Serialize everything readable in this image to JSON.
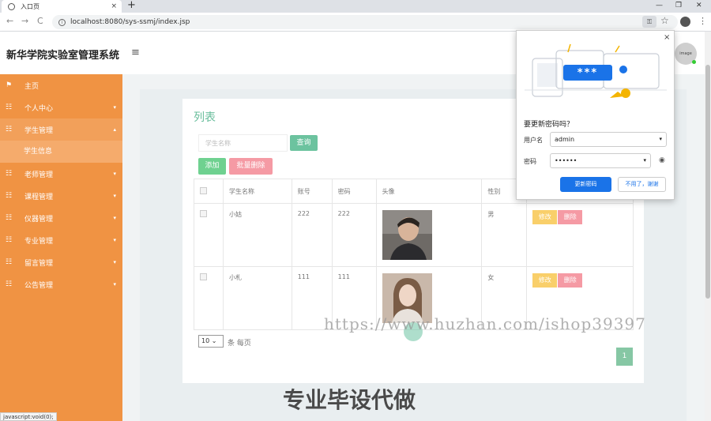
{
  "browser": {
    "tab_title": "入口页",
    "tab_close": "×",
    "new_tab": "+",
    "url": "localhost:8080/sys-ssmj/index.jsp",
    "back": "←",
    "forward": "→",
    "reload": "C",
    "info": "i",
    "key": "⚿",
    "star": "☆",
    "menu": "⋮",
    "minimize": "—",
    "restore": "❐",
    "close": "✕",
    "status_text": "javascript:void(0);"
  },
  "header": {
    "title": "新华学院实验室管理系统",
    "menu_icon": "≡",
    "avatar_text": "image"
  },
  "sidebar": {
    "items": [
      {
        "label": "主页",
        "icon": "flag-icon",
        "glyph": "⚑",
        "caret": ""
      },
      {
        "label": "个人中心",
        "icon": "grid-icon",
        "glyph": "☷",
        "caret": "▾"
      },
      {
        "label": "学生管理",
        "icon": "grid-icon",
        "glyph": "☷",
        "caret": "▴"
      },
      {
        "label": "老师管理",
        "icon": "grid-icon",
        "glyph": "☷",
        "caret": "▾"
      },
      {
        "label": "课程管理",
        "icon": "grid-icon",
        "glyph": "☷",
        "caret": "▾"
      },
      {
        "label": "仪器管理",
        "icon": "grid-icon",
        "glyph": "☷",
        "caret": "▾"
      },
      {
        "label": "专业管理",
        "icon": "grid-icon",
        "glyph": "☷",
        "caret": "▾"
      },
      {
        "label": "留言管理",
        "icon": "grid-icon",
        "glyph": "☷",
        "caret": "▾"
      },
      {
        "label": "公告管理",
        "icon": "grid-icon",
        "glyph": "☷",
        "caret": "▾"
      }
    ],
    "subitem": "学生信息"
  },
  "list": {
    "title": "列表",
    "search_placeholder": "学生名称",
    "search_button": "查询",
    "add_button": "添加",
    "batch_delete_button": "批量删除",
    "columns": [
      "",
      "学生名称",
      "账号",
      "密码",
      "头像",
      "性别",
      ""
    ],
    "rows": [
      {
        "name": "小姑",
        "account": "222",
        "password": "222",
        "gender": "男",
        "edit": "修改",
        "delete": "删除"
      },
      {
        "name": "小札",
        "account": "111",
        "password": "111",
        "gender": "女",
        "edit": "修改",
        "delete": "删除"
      }
    ],
    "page_size": "10",
    "page_size_caret": "⌄",
    "page_size_label": "条 每页",
    "current_page": "1"
  },
  "password_popup": {
    "title": "要更新密码吗？",
    "username_label": "用户名",
    "username_value": "admin",
    "password_label": "密码",
    "password_value": "••••••",
    "caret": "▾",
    "eye": "◉",
    "stars": "***",
    "update_button": "更新密码",
    "no_button": "不用了，谢谢",
    "close": "×"
  },
  "watermark": {
    "url": "https://www.huzhan.com/ishop39397",
    "text": "专业毕设代做"
  },
  "colors": {
    "sidebar": "#f09343",
    "accent_green": "#6cc39f",
    "delete_pink": "#f59aa4",
    "edit_yellow": "#f9cf6a",
    "chrome_blue": "#1a73e8"
  }
}
